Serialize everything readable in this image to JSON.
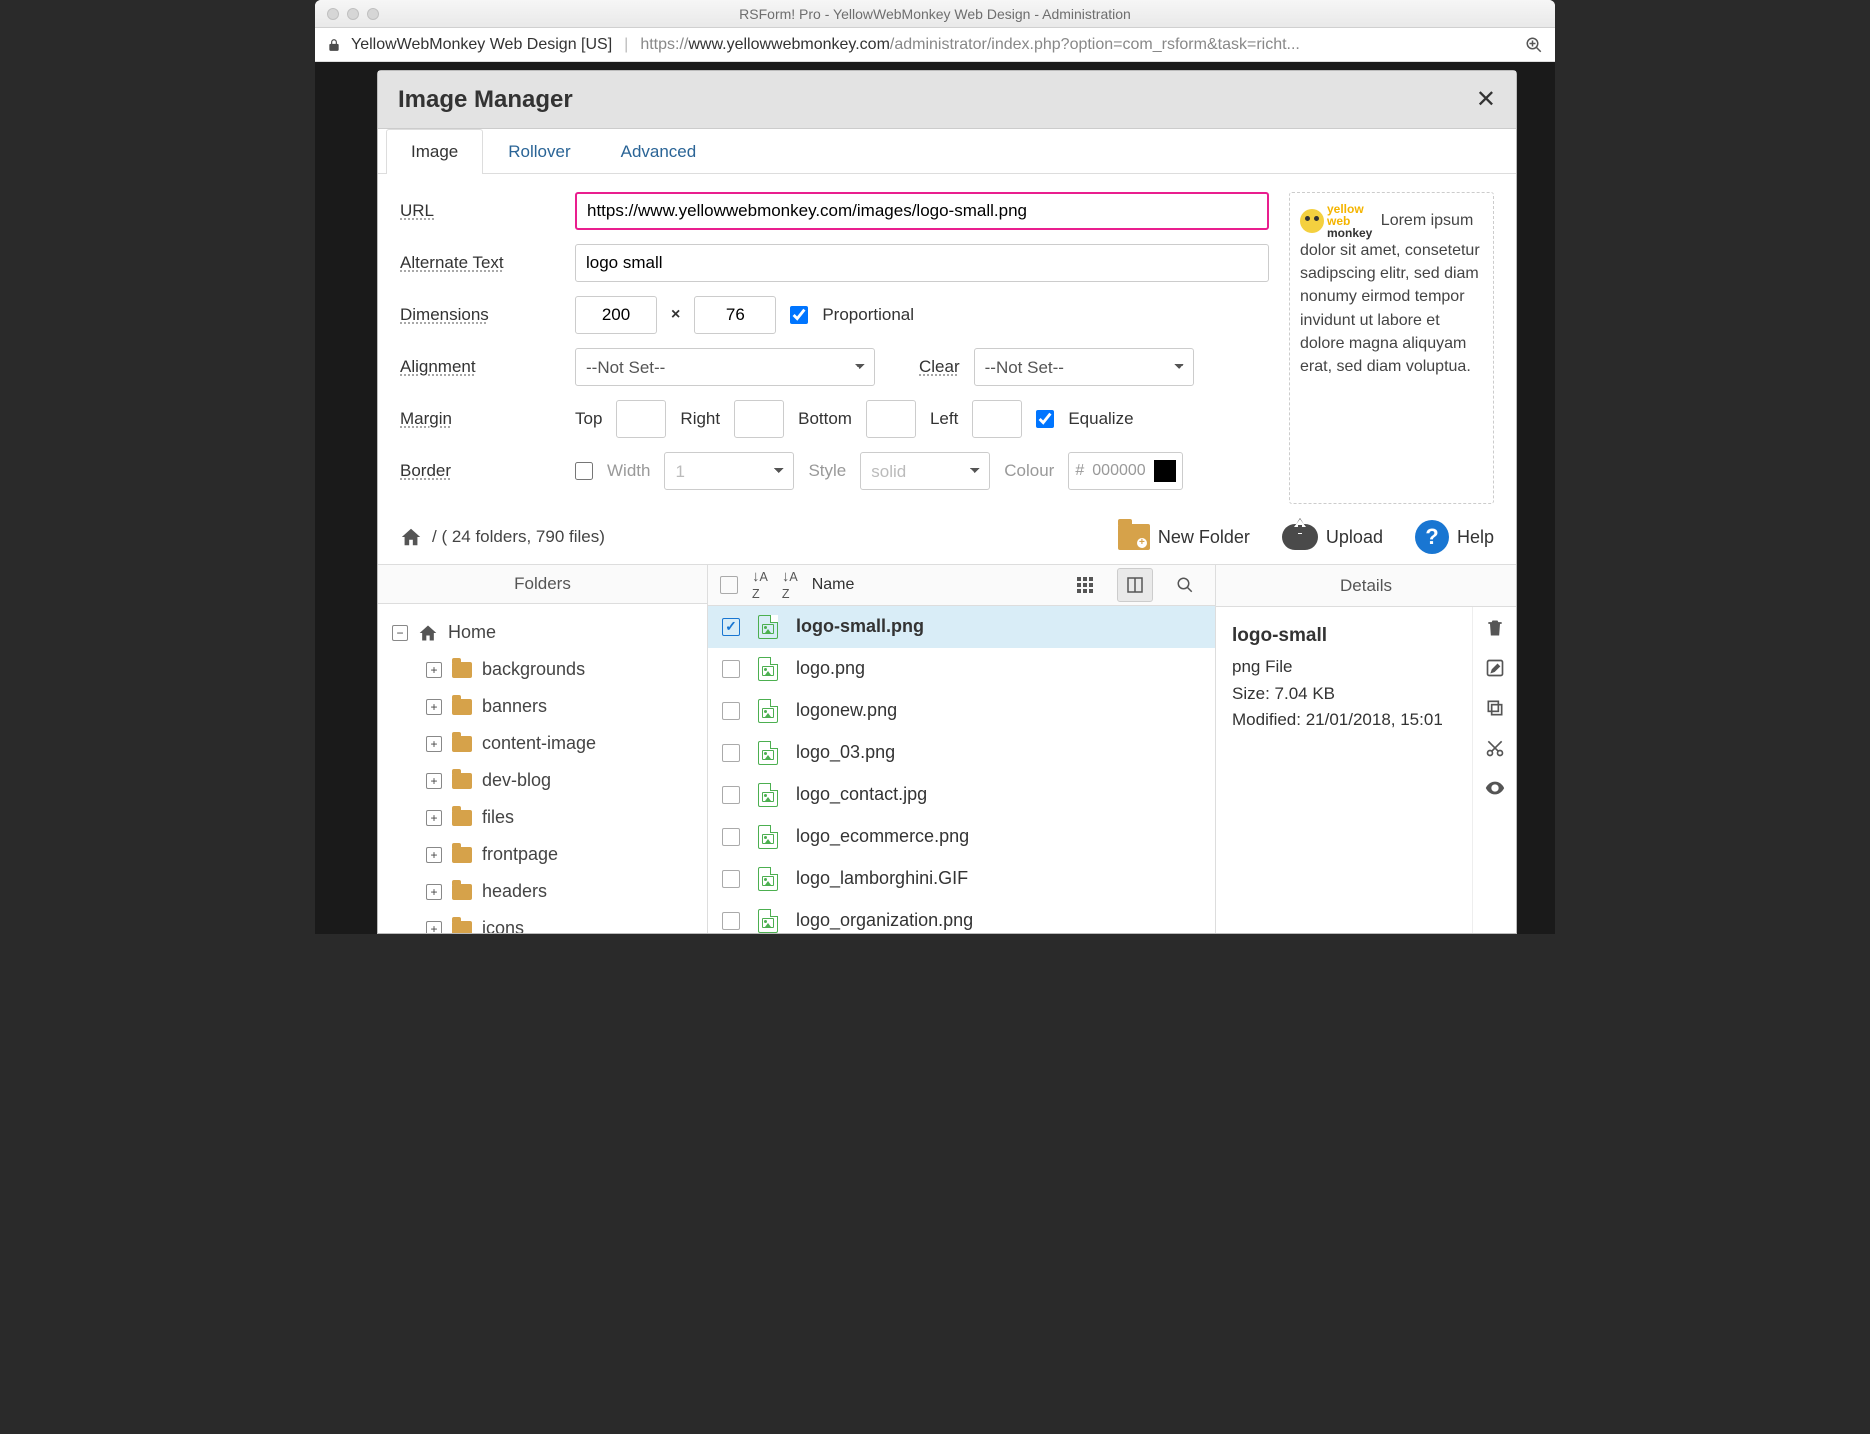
{
  "window_title": "RSForm! Pro - YellowWebMonkey Web Design - Administration",
  "urlbar": {
    "site": "YellowWebMonkey Web Design [US]",
    "proto": "https://",
    "domain": "www.yellowwebmonkey.com",
    "path": "/administrator/index.php?option=com_rsform&task=richt..."
  },
  "modal": {
    "title": "Image Manager"
  },
  "tabs": [
    "Image",
    "Rollover",
    "Advanced"
  ],
  "form": {
    "url_label": "URL",
    "url_value": "https://www.yellowwebmonkey.com/images/logo-small.png",
    "alt_label": "Alternate Text",
    "alt_value": "logo small",
    "dim_label": "Dimensions",
    "dim_w": "200",
    "dim_h": "76",
    "proportional": "Proportional",
    "align_label": "Alignment",
    "align_value": "--Not Set--",
    "clear_label": "Clear",
    "clear_value": "--Not Set--",
    "margin_label": "Margin",
    "margin_top": "Top",
    "margin_right": "Right",
    "margin_bottom": "Bottom",
    "margin_left": "Left",
    "equalize": "Equalize",
    "border_label": "Border",
    "border_width": "Width",
    "border_width_val": "1",
    "border_style": "Style",
    "border_style_val": "solid",
    "border_colour": "Colour",
    "border_colour_val": "000000"
  },
  "preview_text": " Lorem ipsum dolor sit amet, consetetur sadipscing elitr, sed diam nonumy eirmod tempor invidunt ut labore et dolore magna aliquyam erat, sed diam voluptua.",
  "crumb": "/ ( 24 folders, 790 files)",
  "toolbar": {
    "newfolder": "New Folder",
    "upload": "Upload",
    "help": "Help"
  },
  "panes": {
    "folders": "Folders",
    "name": "Name",
    "details": "Details"
  },
  "tree_root": "Home",
  "tree": [
    "backgrounds",
    "banners",
    "content-image",
    "dev-blog",
    "files",
    "frontpage",
    "headers",
    "icons"
  ],
  "files": [
    {
      "name": "logo-small.png",
      "selected": true
    },
    {
      "name": "logo.png",
      "selected": false
    },
    {
      "name": "logonew.png",
      "selected": false
    },
    {
      "name": "logo_03.png",
      "selected": false
    },
    {
      "name": "logo_contact.jpg",
      "selected": false
    },
    {
      "name": "logo_ecommerce.png",
      "selected": false
    },
    {
      "name": "logo_lamborghini.GIF",
      "selected": false
    },
    {
      "name": "logo_organization.png",
      "selected": false
    }
  ],
  "details": {
    "name": "logo-small",
    "type": "png File",
    "size": "Size: 7.04 KB",
    "modified": "Modified: 21/01/2018, 15:01"
  }
}
